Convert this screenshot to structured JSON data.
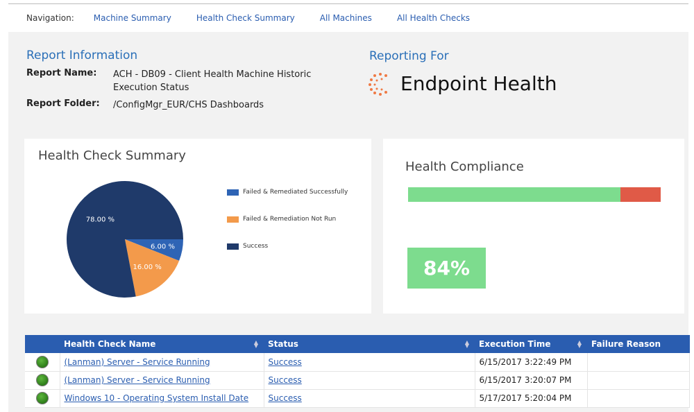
{
  "nav": {
    "label": "Navigation:",
    "links": [
      "Machine Summary",
      "Health Check Summary",
      "All Machines",
      "All Health Checks"
    ]
  },
  "report_info": {
    "heading": "Report Information",
    "name_label": "Report Name:",
    "name_value": "ACH - DB09 - Client Health Machine Historic Execution Status",
    "folder_label": "Report Folder:",
    "folder_value": "/ConfigMgr_EUR/CHS Dashboards"
  },
  "reporting_for": {
    "heading": "Reporting For",
    "brand": "Endpoint Health"
  },
  "chart_data": {
    "type": "pie",
    "title": "Health Check Summary",
    "legend_position": "right",
    "slices": [
      {
        "name": "Failed & Remediated Successfully",
        "value": 6,
        "label": "6.00 %",
        "color": "#2e64b5"
      },
      {
        "name": "Failed & Remediation Not Run",
        "value": 16,
        "label": "16.00 %",
        "color": "#f39a4b"
      },
      {
        "name": "Success",
        "value": 78,
        "label": "78.00 %",
        "color": "#1f3a6a"
      }
    ]
  },
  "compliance": {
    "title": "Health Compliance",
    "percent": 84,
    "label": "84%",
    "good_color": "#7ddc8e",
    "bad_color": "#e05a47"
  },
  "table": {
    "headers": [
      "Health Check Name",
      "Status",
      "Execution Time",
      "Failure Reason"
    ],
    "rows": [
      {
        "name": "(Lanman) Server - Service Running",
        "status": "Success",
        "time": "6/15/2017 3:22:49 PM",
        "reason": ""
      },
      {
        "name": "(Lanman) Server - Service Running",
        "status": "Success",
        "time": "6/15/2017 3:20:07 PM",
        "reason": ""
      },
      {
        "name": "Windows 10 - Operating System Install Date",
        "status": "Success",
        "time": "5/17/2017 5:20:04 PM",
        "reason": ""
      }
    ]
  }
}
